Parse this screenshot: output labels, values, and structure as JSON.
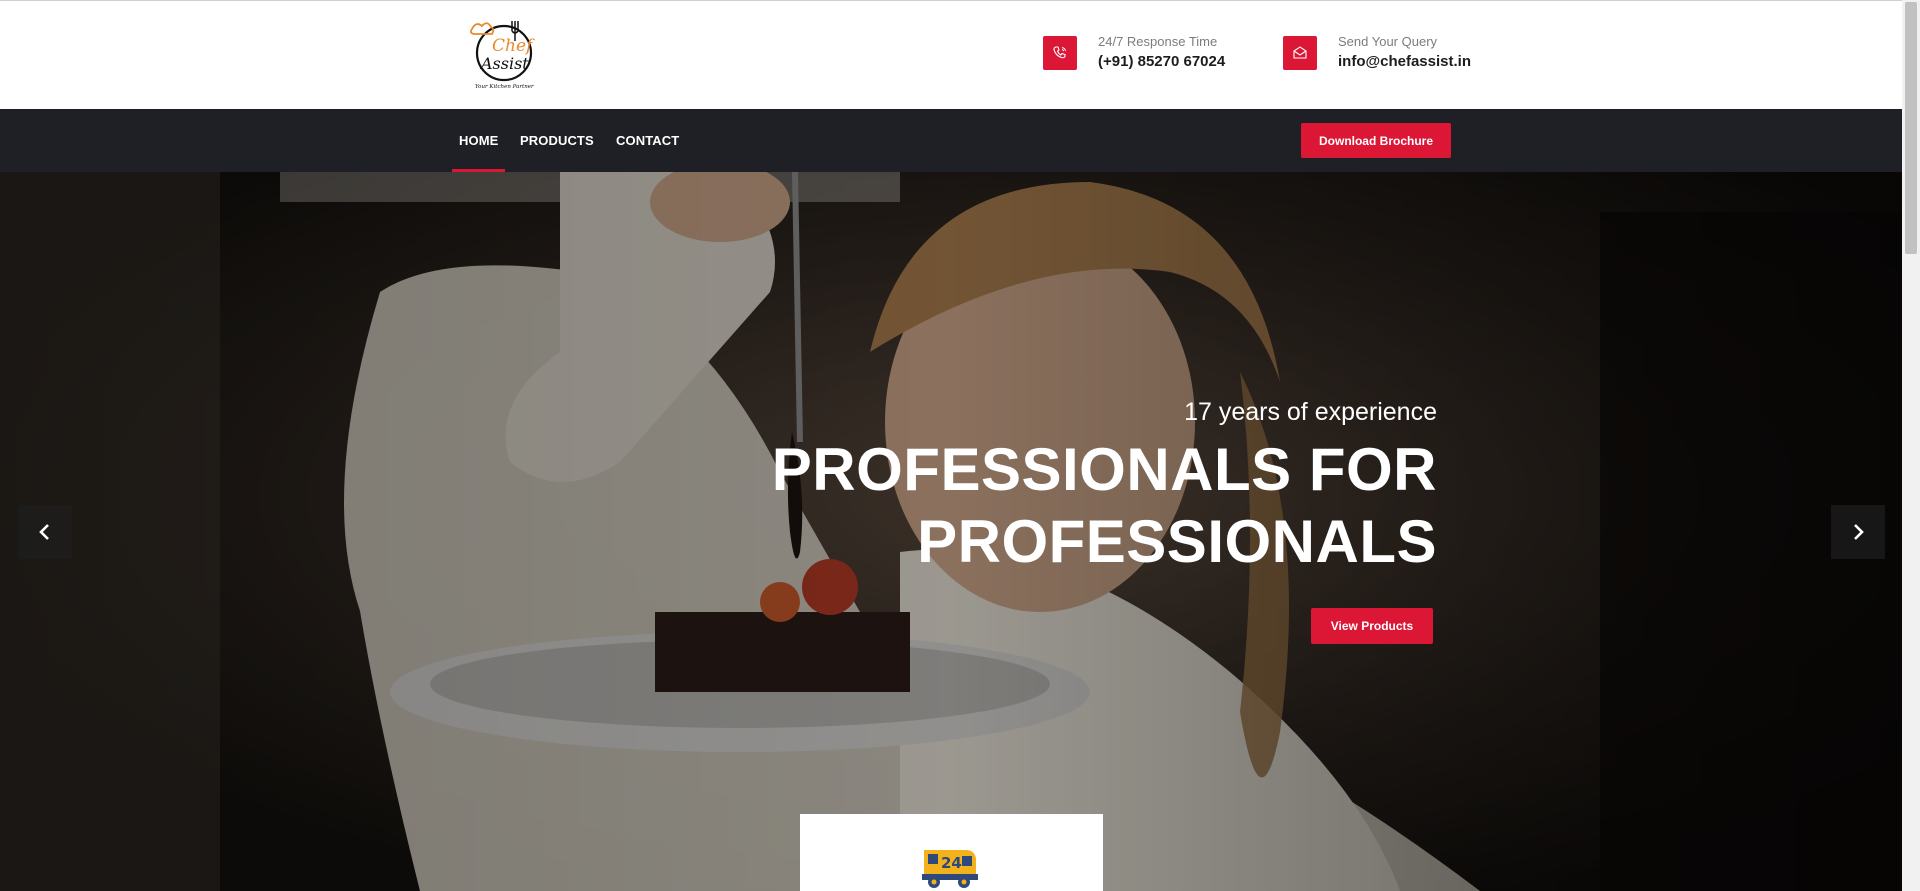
{
  "header": {
    "logo_text": "Chef Assist",
    "logo_tagline": "Your Kitchen Partner",
    "phone": {
      "label": "24/7 Response Time",
      "value": "(+91) 85270 67024",
      "icon": "phone-icon"
    },
    "email": {
      "label": "Send Your Query",
      "value": "info@chefassist.in",
      "icon": "mail-icon"
    }
  },
  "nav": {
    "items": [
      {
        "label": "HOME",
        "active": true
      },
      {
        "label": "PRODUCTS",
        "active": false
      },
      {
        "label": "CONTACT",
        "active": false
      }
    ],
    "cta": "Download Brochure"
  },
  "hero": {
    "subtitle": "17 years of experience",
    "title": "PROFESSIONALS FOR PROFESSIONALS",
    "cta": "View Products",
    "prev_icon": "chevron-left-icon",
    "next_icon": "chevron-right-icon"
  },
  "feature": {
    "badge": "24",
    "icon": "delivery-truck-icon"
  },
  "colors": {
    "accent": "#dc1635",
    "navbar": "#1e2025",
    "logo_orange": "#e8892b"
  }
}
